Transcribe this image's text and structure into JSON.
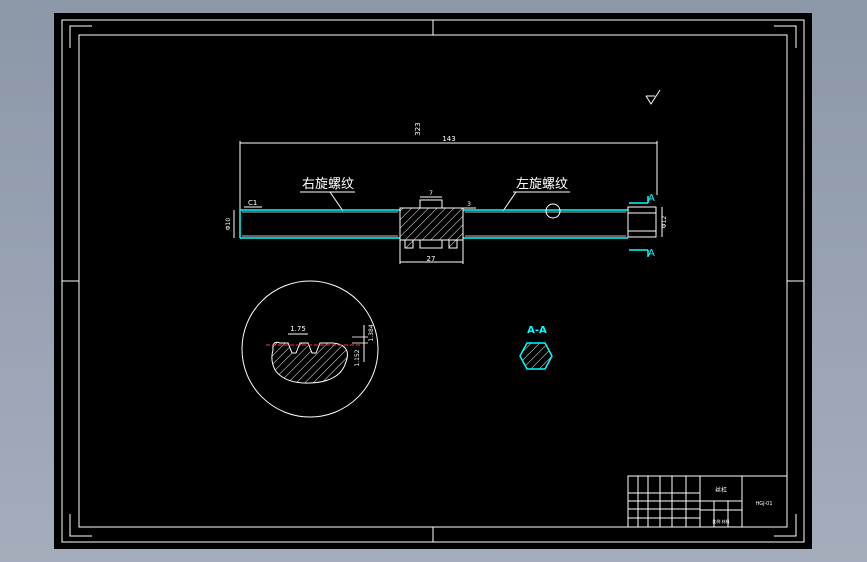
{
  "drawing": {
    "shaft_annotations": {
      "right_thread_label": "右旋螺纹",
      "left_thread_label": "左旋螺纹",
      "chamfer": "C1",
      "overall_length_top": "323",
      "inner_length": "143",
      "hub_width": "27",
      "step_small": "7",
      "step_side": "3",
      "diameter_left": "Φ10",
      "diameter_right": "Φ12",
      "section_marker": "A"
    },
    "detail_view": {
      "pitch": "1.75",
      "depth_upper": "1.384",
      "depth_lower": "1.152"
    },
    "section_view": {
      "title": "A-A"
    },
    "title_block": {
      "part_name": "丝杠",
      "drawing_number": "HGJ-01",
      "small_cell_text": "比例 材料"
    }
  },
  "colors": {
    "background": "#000000",
    "lines": "#ffffff",
    "highlight": "#00ffff",
    "dimension_text": "#ffffff"
  }
}
